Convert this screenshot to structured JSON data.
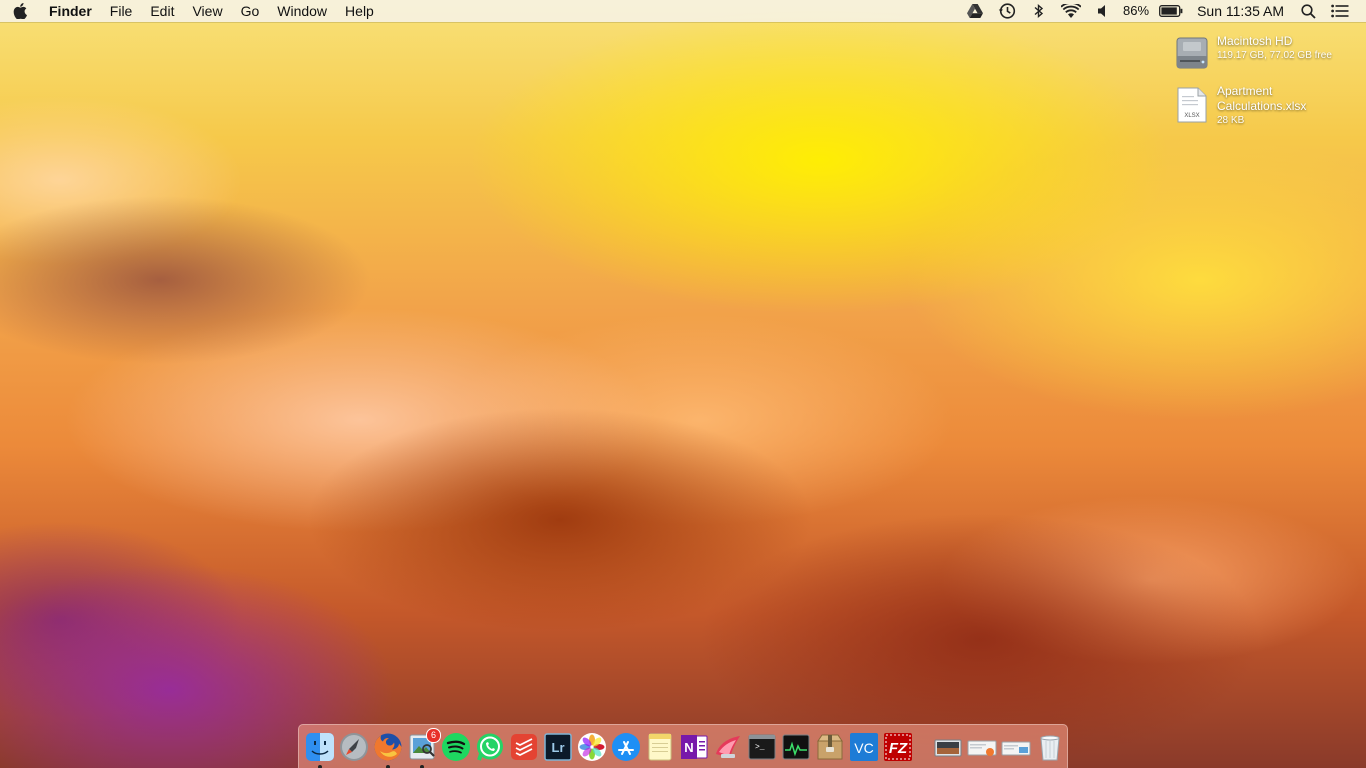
{
  "menubar": {
    "app_name": "Finder",
    "menus": [
      "File",
      "Edit",
      "View",
      "Go",
      "Window",
      "Help"
    ],
    "battery_percent": "86%",
    "clock": "Sun 11:35 AM"
  },
  "desktop_icons": [
    {
      "name": "Macintosh HD",
      "detail": "119.17 GB, 77.02 GB free",
      "icon": "hard-drive-icon"
    },
    {
      "name_line1": "Apartment",
      "name_line2": "Calculations.xlsx",
      "detail": "28 KB",
      "file_ext": "XLSX",
      "icon": "xlsx-file-icon"
    }
  ],
  "dock": {
    "apps": [
      {
        "name": "Finder",
        "icon": "finder-icon",
        "running": true
      },
      {
        "name": "Launchpad",
        "icon": "launchpad-icon",
        "running": false
      },
      {
        "name": "Firefox",
        "icon": "firefox-icon",
        "running": true
      },
      {
        "name": "Preview",
        "icon": "preview-icon",
        "running": true,
        "badge": "6"
      },
      {
        "name": "Spotify",
        "icon": "spotify-icon",
        "running": false
      },
      {
        "name": "WhatsApp",
        "icon": "whatsapp-icon",
        "running": false
      },
      {
        "name": "Todoist",
        "icon": "todoist-icon",
        "running": false
      },
      {
        "name": "Lightroom",
        "icon": "lightroom-icon",
        "running": false,
        "label": "Lr"
      },
      {
        "name": "Photos",
        "icon": "photos-icon",
        "running": false
      },
      {
        "name": "App Store",
        "icon": "app-store-icon",
        "running": false
      },
      {
        "name": "Notes",
        "icon": "notes-icon",
        "running": false
      },
      {
        "name": "OneNote",
        "icon": "onenote-icon",
        "running": false,
        "label": "N"
      },
      {
        "name": "CleanMyMac",
        "icon": "cleanmymac-icon",
        "running": false
      },
      {
        "name": "Terminal",
        "icon": "terminal-icon",
        "running": false,
        "label": ">_"
      },
      {
        "name": "Activity Monitor",
        "icon": "activity-monitor-icon",
        "running": false
      },
      {
        "name": "Archive Utility",
        "icon": "archive-icon",
        "running": false
      },
      {
        "name": "VS Code",
        "icon": "vscode-icon",
        "running": false,
        "label": "VC"
      },
      {
        "name": "FileZilla",
        "icon": "filezilla-icon",
        "running": false,
        "label": "FZ"
      }
    ],
    "stacks": [
      {
        "name": "Photo Booth stack",
        "icon": "photo-stack-icon"
      },
      {
        "name": "Downloads stack",
        "icon": "downloads-stack-icon"
      },
      {
        "name": "Documents stack",
        "icon": "documents-stack-icon"
      },
      {
        "name": "Trash",
        "icon": "trash-icon"
      }
    ]
  },
  "colors": {
    "menubar_bg": "#f6f4ee",
    "dock_bg": "#eb9682",
    "badge": "#e8312a"
  }
}
